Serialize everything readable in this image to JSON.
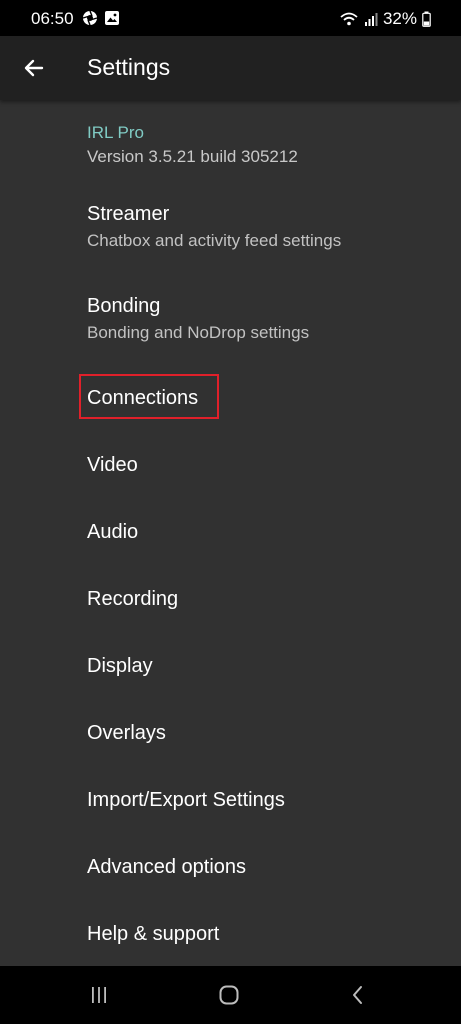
{
  "status_bar": {
    "time": "06:50",
    "left_icons": [
      "aperture-icon",
      "gallery-icon"
    ],
    "right_icons": [
      "wifi-icon",
      "signal-icon",
      "battery-icon"
    ],
    "battery": "32%"
  },
  "app_bar": {
    "back_icon": "arrow-left-icon",
    "title": "Settings"
  },
  "about": {
    "app_name": "IRL Pro",
    "version": "Version 3.5.21 build 305212"
  },
  "preferences": [
    {
      "title": "Streamer",
      "summary": "Chatbox and activity feed settings"
    },
    {
      "title": "Bonding",
      "summary": "Bonding and NoDrop settings"
    },
    {
      "title": "Connections",
      "summary": ""
    },
    {
      "title": "Video",
      "summary": ""
    },
    {
      "title": "Audio",
      "summary": ""
    },
    {
      "title": "Recording",
      "summary": ""
    },
    {
      "title": "Display",
      "summary": ""
    },
    {
      "title": "Overlays",
      "summary": ""
    },
    {
      "title": "Import/Export Settings",
      "summary": ""
    },
    {
      "title": "Advanced options",
      "summary": ""
    },
    {
      "title": "Help & support",
      "summary": ""
    }
  ],
  "highlighted_item": "Connections",
  "nav_bar": {
    "buttons": [
      "recent-apps-icon",
      "home-icon",
      "back-icon"
    ]
  },
  "colors": {
    "background": "#313131",
    "app_bar": "#212121",
    "accent": "#80cbc4",
    "highlight": "#e0202a"
  }
}
